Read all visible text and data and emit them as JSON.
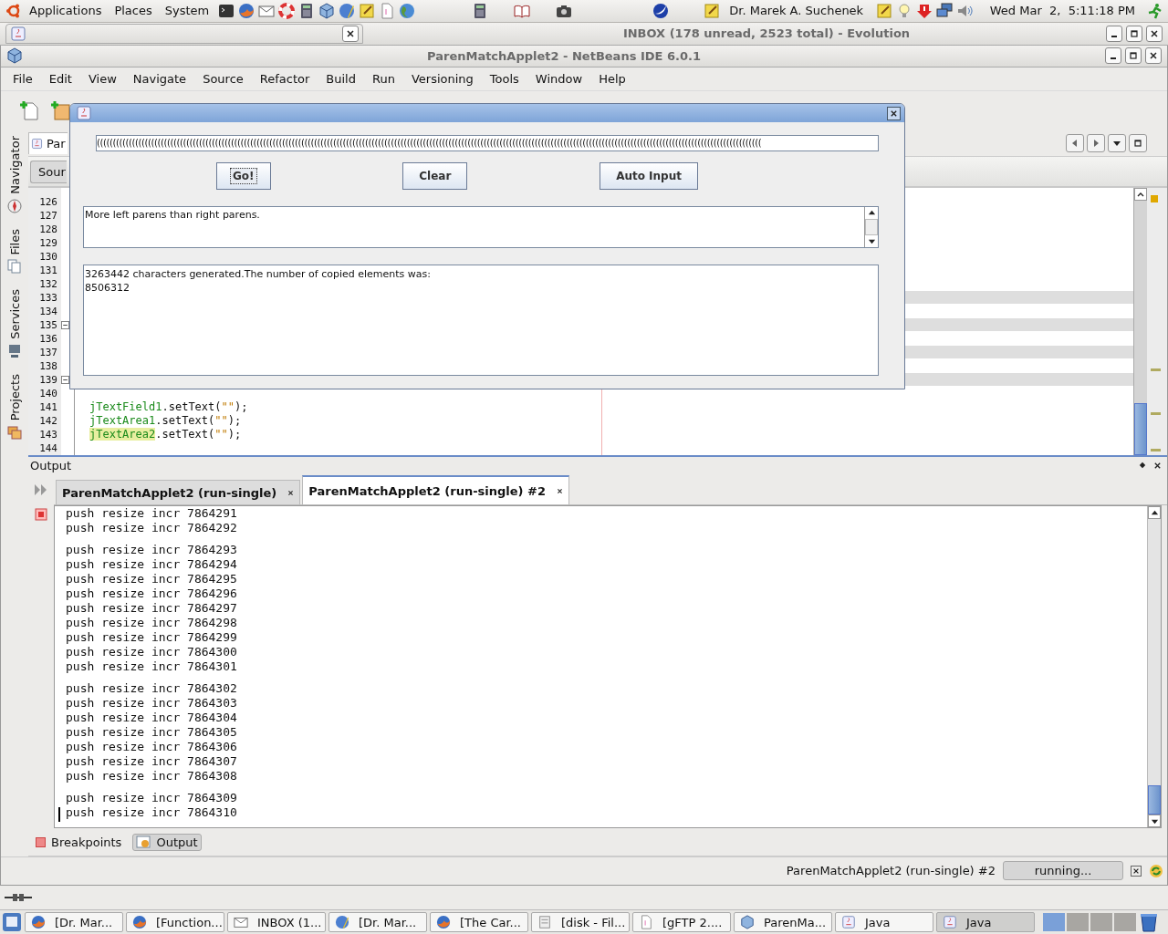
{
  "top_panel": {
    "menus": [
      "Applications",
      "Places",
      "System"
    ],
    "user": "Dr. Marek A. Suchenek",
    "clock": "Wed Mar  2,  5:11:18 PM"
  },
  "background_window": {
    "title": "INBOX (178 unread, 2523 total) - Evolution"
  },
  "window": {
    "title": "ParenMatchApplet2 - NetBeans IDE 6.0.1"
  },
  "menu": [
    "File",
    "Edit",
    "View",
    "Navigate",
    "Source",
    "Refactor",
    "Build",
    "Run",
    "Versioning",
    "Tools",
    "Window",
    "Help"
  ],
  "side_tabs": [
    "Navigator",
    "Files",
    "Services",
    "Projects"
  ],
  "editor": {
    "tab": "Par",
    "view_tab": "Sour",
    "lines": [
      {
        "number": "126",
        "fold": false
      },
      {
        "number": "127",
        "fold": false
      },
      {
        "number": "128",
        "fold": false
      },
      {
        "number": "129",
        "fold": false
      },
      {
        "number": "130",
        "fold": false
      },
      {
        "number": "131",
        "fold": false
      },
      {
        "number": "132",
        "fold": false
      },
      {
        "number": "133",
        "fold": false
      },
      {
        "number": "134",
        "fold": false
      },
      {
        "number": "135",
        "fold": true
      },
      {
        "number": "136",
        "fold": false
      },
      {
        "number": "137",
        "fold": false
      },
      {
        "number": "138",
        "fold": false
      },
      {
        "number": "139",
        "fold": true
      },
      {
        "number": "140",
        "fold": false
      },
      {
        "number": "141",
        "fold": false,
        "code": [
          {
            "text": "jTextField1",
            "kind": "field"
          },
          {
            "text": ".setText(",
            "kind": "plain"
          },
          {
            "text": "\"\"",
            "kind": "string"
          },
          {
            "text": ");",
            "kind": "plain"
          }
        ]
      },
      {
        "number": "142",
        "fold": false,
        "code": [
          {
            "text": "jTextArea1",
            "kind": "field"
          },
          {
            "text": ".setText(",
            "kind": "plain"
          },
          {
            "text": "\"\"",
            "kind": "string"
          },
          {
            "text": ");",
            "kind": "plain"
          }
        ]
      },
      {
        "number": "143",
        "fold": false,
        "code": [
          {
            "text": "jTextArea2",
            "kind": "marked"
          },
          {
            "text": ".setText(",
            "kind": "plain"
          },
          {
            "text": "\"\"",
            "kind": "string"
          },
          {
            "text": ");",
            "kind": "plain"
          }
        ]
      },
      {
        "number": "144",
        "fold": false
      }
    ]
  },
  "dialog": {
    "field_value": "((((((((((((((((((((((((((((((((((((((((((((((((((((((((((((((((((((((((((((((((((((((((((((((((((((((((((((((((((((((((((((((((((((((((((((((((((((((((((((((((((((((((((((((((((((((((((((((((((((((((((((((((",
    "buttons": [
      {
        "label": "Go!",
        "focused": true
      },
      {
        "label": "Clear",
        "focused": false
      },
      {
        "label": "Auto Input",
        "focused": false
      }
    ],
    "message": "More left parens than right parens.",
    "result_lines": [
      "3263442 characters generated.The number of copied elements was:",
      "8506312"
    ]
  },
  "output": {
    "label": "Output",
    "tabs": [
      {
        "label": "ParenMatchApplet2 (run-single)",
        "selected": false
      },
      {
        "label": "ParenMatchApplet2 (run-single) #2",
        "selected": true
      }
    ],
    "lines": [
      {
        "text": "push resize incr 7864291",
        "gap_before": false
      },
      {
        "text": "push resize incr 7864292",
        "gap_before": false
      },
      {
        "text": "push resize incr 7864293",
        "gap_before": true
      },
      {
        "text": "push resize incr 7864294",
        "gap_before": false
      },
      {
        "text": "push resize incr 7864295",
        "gap_before": false
      },
      {
        "text": "push resize incr 7864296",
        "gap_before": false
      },
      {
        "text": "push resize incr 7864297",
        "gap_before": false
      },
      {
        "text": "push resize incr 7864298",
        "gap_before": false
      },
      {
        "text": "push resize incr 7864299",
        "gap_before": false
      },
      {
        "text": "push resize incr 7864300",
        "gap_before": false
      },
      {
        "text": "push resize incr 7864301",
        "gap_before": false
      },
      {
        "text": "push resize incr 7864302",
        "gap_before": true
      },
      {
        "text": "push resize incr 7864303",
        "gap_before": false
      },
      {
        "text": "push resize incr 7864304",
        "gap_before": false
      },
      {
        "text": "push resize incr 7864305",
        "gap_before": false
      },
      {
        "text": "push resize incr 7864306",
        "gap_before": false
      },
      {
        "text": "push resize incr 7864307",
        "gap_before": false
      },
      {
        "text": "push resize incr 7864308",
        "gap_before": false
      },
      {
        "text": "push resize incr 7864309",
        "gap_before": true
      },
      {
        "text": "push resize incr 7864310",
        "gap_before": false
      }
    ]
  },
  "bottom_tabs": [
    {
      "label": "Breakpoints",
      "selected": false
    },
    {
      "label": "Output",
      "selected": true
    }
  ],
  "status": {
    "task": "ParenMatchApplet2 (run-single) #2",
    "progress": "running..."
  },
  "taskbar": [
    {
      "label": "[Dr. Mar...",
      "kind": "browser",
      "selected": false
    },
    {
      "label": "[Function...",
      "kind": "browser",
      "selected": false
    },
    {
      "label": "INBOX (1...",
      "kind": "mail",
      "selected": false
    },
    {
      "label": "[Dr. Mar...",
      "kind": "web",
      "selected": false
    },
    {
      "label": "[The Car...",
      "kind": "browser",
      "selected": false
    },
    {
      "label": "[disk - Fil...",
      "kind": "file",
      "selected": false
    },
    {
      "label": "[gFTP 2....",
      "kind": "ftp",
      "selected": false
    },
    {
      "label": "ParenMa...",
      "kind": "ide",
      "selected": false
    },
    {
      "label": "Java",
      "kind": "java",
      "selected": false
    },
    {
      "label": "Java",
      "kind": "java",
      "selected": true
    }
  ],
  "workspaces": [
    {
      "selected": true
    },
    {
      "selected": false
    },
    {
      "selected": false
    },
    {
      "selected": false
    }
  ]
}
